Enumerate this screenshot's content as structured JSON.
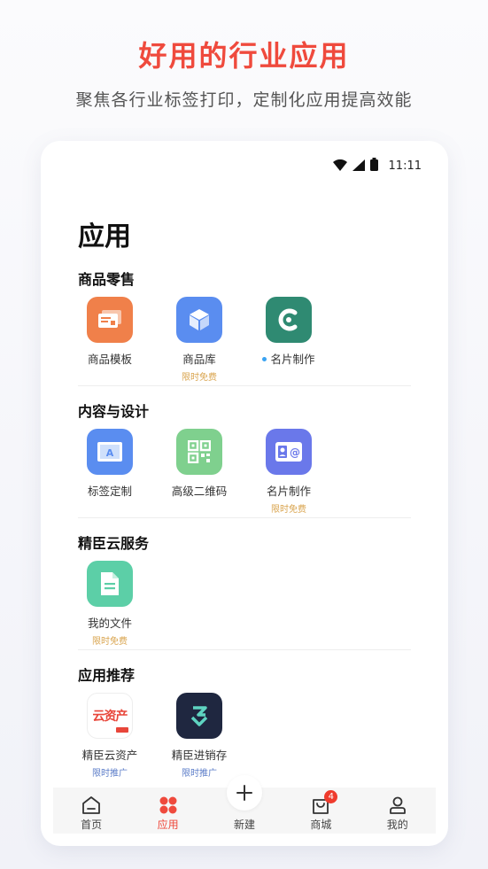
{
  "promo": {
    "title": "好用的行业应用",
    "subtitle": "聚焦各行业标签打印，定制化应用提高效能"
  },
  "status_bar": {
    "time": "11:11"
  },
  "page": {
    "title": "应用"
  },
  "sections": [
    {
      "title": "商品零售",
      "apps": [
        {
          "label": "商品模板",
          "tag": "",
          "icon": "template-icon",
          "color": "#f0804a"
        },
        {
          "label": "商品库",
          "tag": "限时免费",
          "icon": "package-box-icon",
          "color": "#5a8df0"
        },
        {
          "label": "名片制作",
          "tag": "",
          "icon": "business-card-c-icon",
          "color": "#2f8a72",
          "dot": true
        }
      ]
    },
    {
      "title": "内容与设计",
      "apps": [
        {
          "label": "标签定制",
          "tag": "",
          "icon": "label-design-icon",
          "color": "#5a8df0"
        },
        {
          "label": "高级二维码",
          "tag": "",
          "icon": "qr-code-icon",
          "color": "#7fd08e"
        },
        {
          "label": "名片制作",
          "tag": "限时免费",
          "icon": "contact-card-icon",
          "color": "#6a78ea"
        }
      ]
    },
    {
      "title": "精臣云服务",
      "apps": [
        {
          "label": "我的文件",
          "tag": "限时免费",
          "icon": "document-icon",
          "color": "#5ccfa7"
        }
      ]
    },
    {
      "title": "应用推荐",
      "apps": [
        {
          "label": "精臣云资产",
          "tag": "限时推广",
          "icon": "cloud-asset-logo",
          "logo_text": "云资产"
        },
        {
          "label": "精臣进销存",
          "tag": "限时推广",
          "icon": "inventory-logo",
          "color": "#1f2740"
        }
      ]
    }
  ],
  "tab_bar": {
    "tabs": [
      {
        "label": "首页",
        "icon": "home-icon"
      },
      {
        "label": "应用",
        "icon": "apps-grid-icon",
        "active": true
      },
      {
        "label": "新建",
        "icon": "plus-icon"
      },
      {
        "label": "商城",
        "icon": "shopping-bag-icon",
        "badge": "4"
      },
      {
        "label": "我的",
        "icon": "user-icon"
      }
    ]
  },
  "colors": {
    "accent": "#ef4a3d",
    "free_tag": "#d9a44e",
    "promo_tag": "#5b7cc8"
  }
}
